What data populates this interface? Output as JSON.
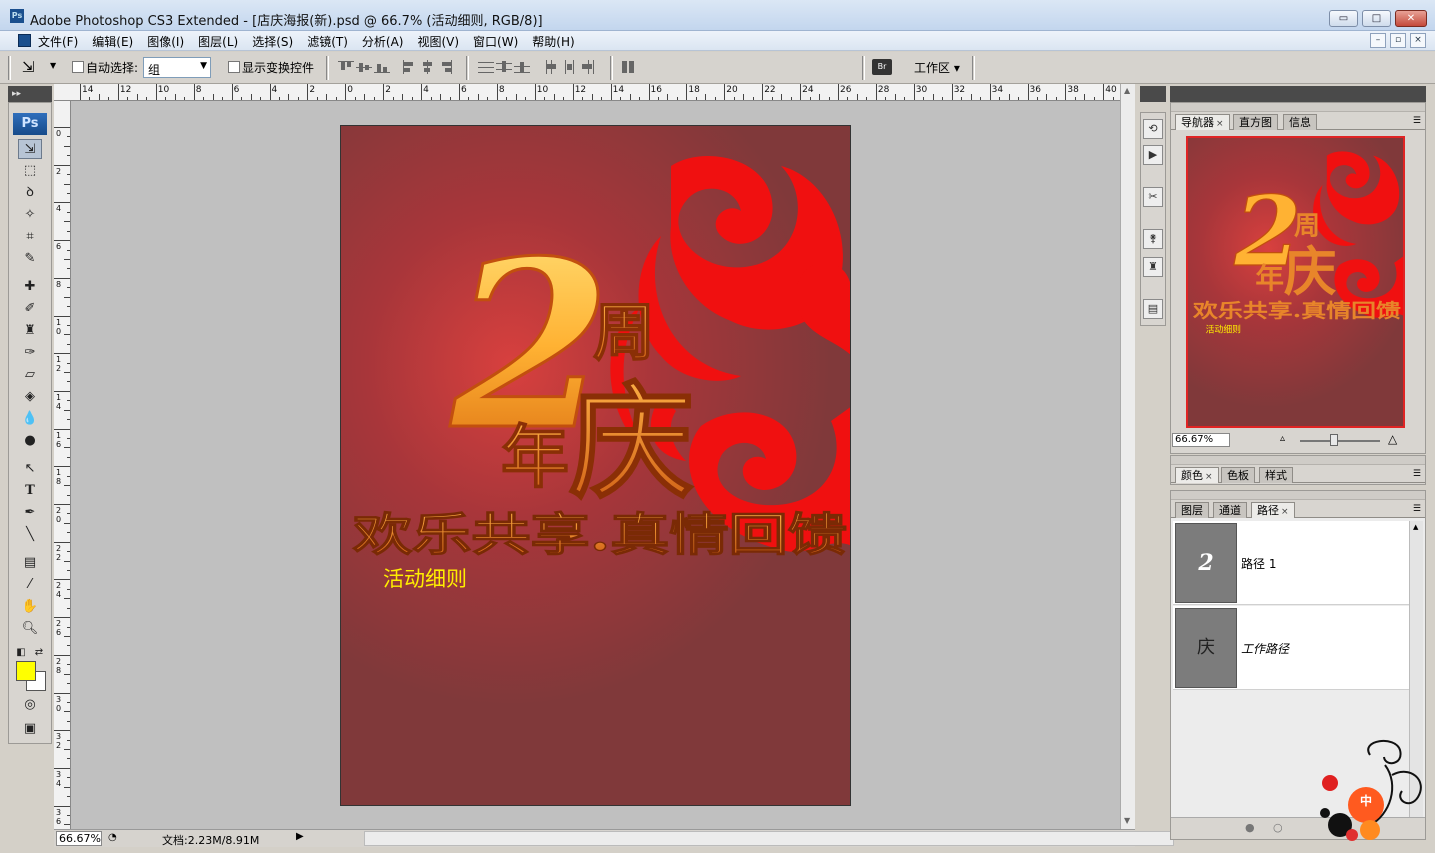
{
  "window": {
    "title": "Adobe Photoshop CS3 Extended - [店庆海报(新).psd @ 66.7% (活动细则, RGB/8)]",
    "minimize": "▭",
    "maximize": "□",
    "close": "✕"
  },
  "menubar": {
    "items": [
      "文件(F)",
      "编辑(E)",
      "图像(I)",
      "图层(L)",
      "选择(S)",
      "滤镜(T)",
      "分析(A)",
      "视图(V)",
      "窗口(W)",
      "帮助(H)"
    ],
    "mdi": [
      "–",
      "▫",
      "×"
    ]
  },
  "options": {
    "auto_select_label": "自动选择:",
    "auto_select_value": "组",
    "show_transform_label": "显示变换控件",
    "workspace_label": "工作区 ▾"
  },
  "rulers": {
    "h": [
      "14",
      "12",
      "10",
      "8",
      "6",
      "4",
      "2",
      "0",
      "2",
      "4",
      "6",
      "8",
      "10",
      "12",
      "14",
      "16",
      "18",
      "20",
      "22",
      "24",
      "26",
      "28",
      "30",
      "32",
      "34",
      "36",
      "38",
      "40"
    ],
    "v": [
      "0",
      "2",
      "4",
      "6",
      "8",
      "10",
      "12",
      "14",
      "16",
      "18",
      "20",
      "22",
      "24",
      "26",
      "28",
      "30",
      "32",
      "34",
      "36"
    ]
  },
  "poster": {
    "big_number": "2",
    "zhou": "周",
    "nian": "年",
    "qing": "庆",
    "slogan": "欢乐共享.真情回馈",
    "detail": "活动细则"
  },
  "status": {
    "zoom": "66.67%",
    "doc_info": "文档:2.23M/8.91M"
  },
  "navigator_panel": {
    "tabs": [
      "导航器",
      "直方图",
      "信息"
    ],
    "zoom": "66.67%"
  },
  "color_panel": {
    "tabs": [
      "颜色",
      "色板",
      "样式"
    ]
  },
  "paths_panel": {
    "tabs": [
      "图层",
      "通道",
      "路径"
    ],
    "paths": [
      {
        "name": "路径 1",
        "thumb": "2"
      },
      {
        "name": "工作路径",
        "thumb": "庆"
      }
    ]
  },
  "colors": {
    "foreground": "#ffff00",
    "background": "#ffffff",
    "accent": "#e0261f"
  }
}
